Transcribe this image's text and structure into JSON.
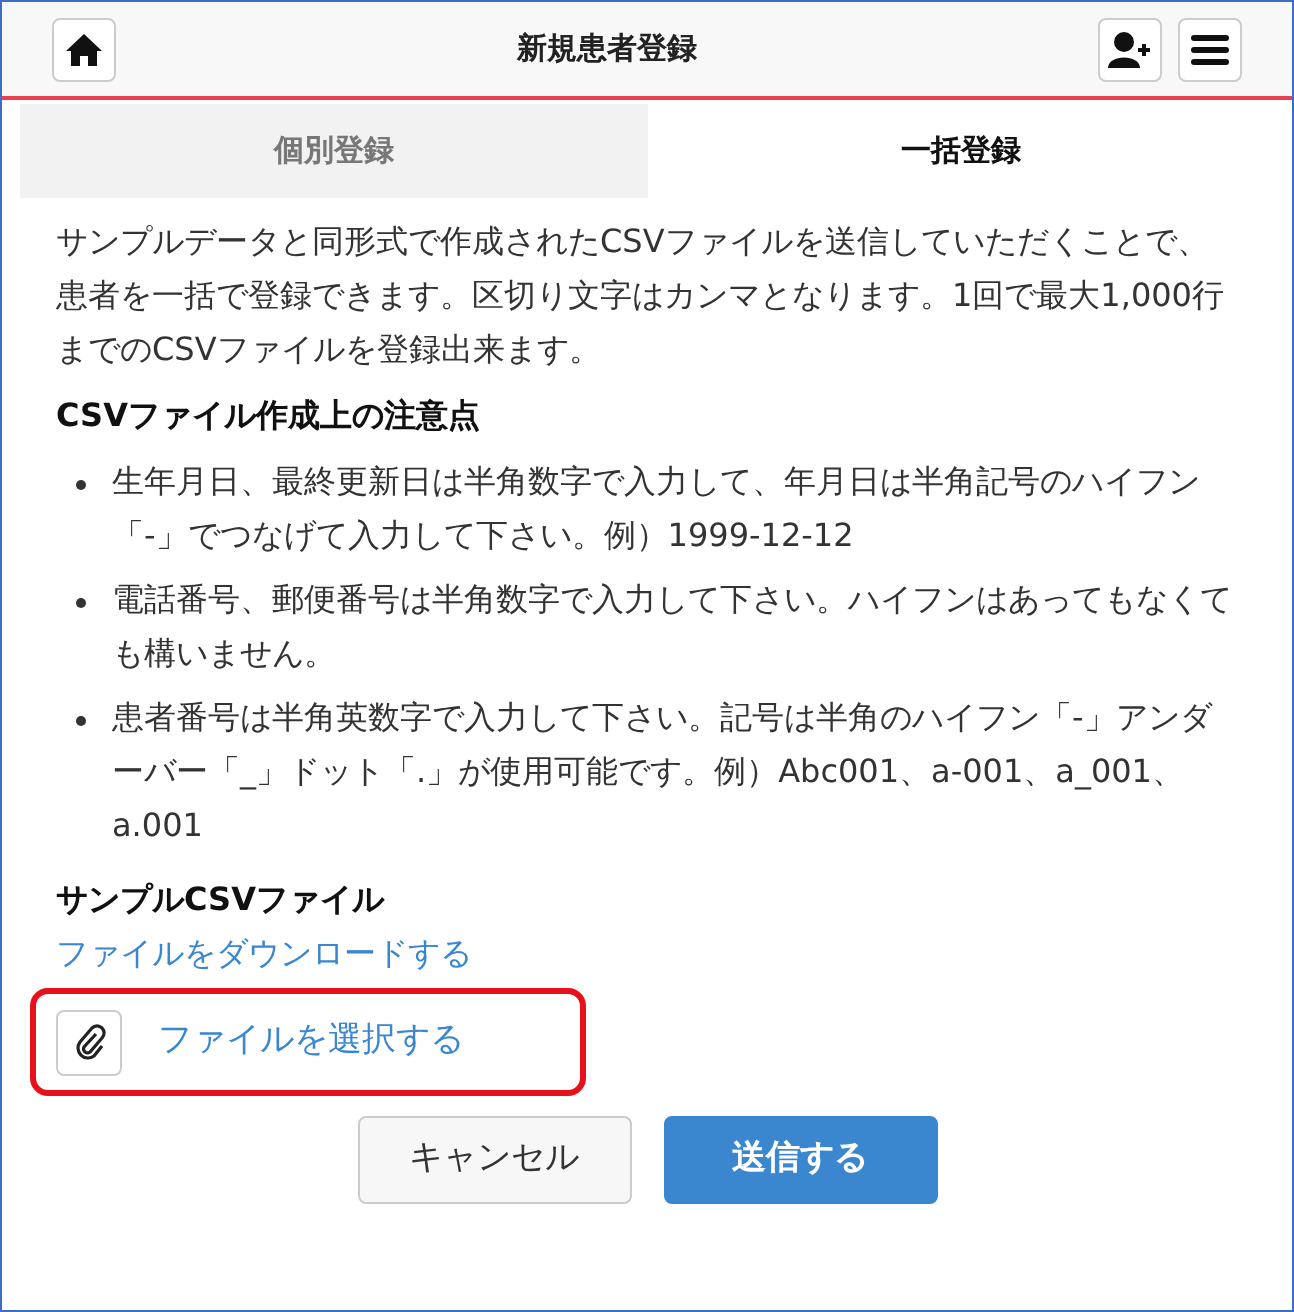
{
  "header": {
    "title": "新規患者登録"
  },
  "tabs": [
    {
      "label": "個別登録",
      "selected": false
    },
    {
      "label": "一括登録",
      "selected": true
    }
  ],
  "intro": "サンプルデータと同形式で作成されたCSVファイルを送信していただくことで、患者を一括で登録できます。区切り文字はカンマとなります。1回で最大1,000行までのCSVファイルを登録出来ます。",
  "notes": {
    "heading": "CSVファイル作成上の注意点",
    "items": [
      "生年月日、最終更新日は半角数字で入力して、年月日は半角記号のハイフン「-」でつなげて入力して下さい。例）1999-12-12",
      "電話番号、郵便番号は半角数字で入力して下さい。ハイフンはあってもなくても構いません。",
      "患者番号は半角英数字で入力して下さい。記号は半角のハイフン「-」アンダーバー「_」ドット「.」が使用可能です。例）Abc001、a-001、a_001、a.001"
    ]
  },
  "sample": {
    "heading": "サンプルCSVファイル",
    "link": "ファイルをダウンロードする"
  },
  "file_picker": {
    "label": "ファイルを選択する",
    "highlighted": true
  },
  "buttons": [
    {
      "label": "キャンセル",
      "kind": "secondary"
    },
    {
      "label": "送信する",
      "kind": "primary"
    }
  ]
}
